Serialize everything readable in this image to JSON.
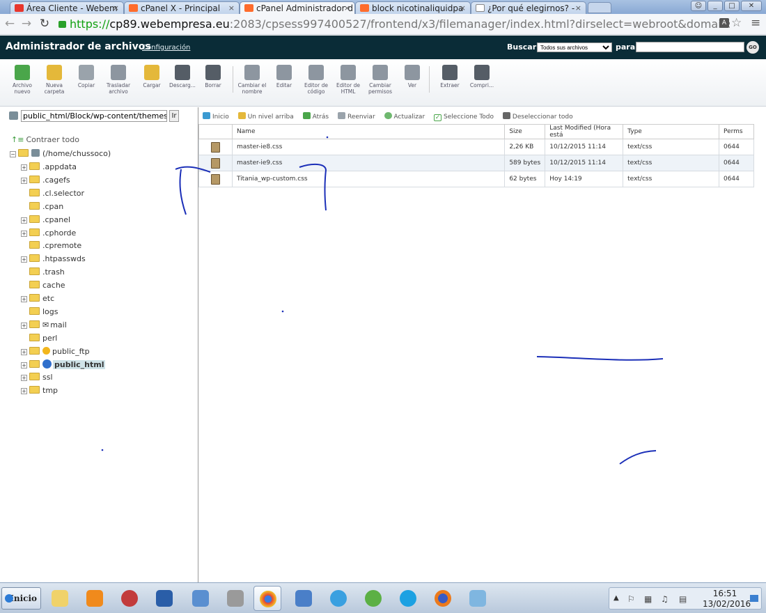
{
  "browser": {
    "tabs": [
      {
        "title": "Área Cliente - Webem",
        "icon_color": "#e8362d"
      },
      {
        "title": "cPanel X - Principal",
        "icon_color": "#ff6c2c"
      },
      {
        "title": "cPanel Administrador d",
        "icon_color": "#ff6c2c"
      },
      {
        "title": "block nicotinaliquidpa",
        "icon_color": "#ff6c2c"
      },
      {
        "title": "¿Por qué elegirnos? - ‎",
        "icon_color": "#dddddd"
      }
    ],
    "url_scheme": "https://",
    "url_host": "cp89.webempresa.eu",
    "url_rest": ":2083/cpsess997400527/frontend/x3/filemanager/index.html?dirselect=webroot&domainselect=block.nicotinaliquidaparavap"
  },
  "header": {
    "title": "Administrador de archivos",
    "config_link": "Configuración",
    "search_label": "Buscar",
    "search_scope": "Todos sus archivos",
    "for_label": "para",
    "go_label": "GO"
  },
  "toolbar": [
    {
      "label": "Archivo nuevo",
      "icon": "new-file-icon",
      "color": "#4aa64a"
    },
    {
      "label": "Nueva carpeta",
      "icon": "new-folder-icon",
      "color": "#e4b83a"
    },
    {
      "label": "Copiar",
      "icon": "copy-icon",
      "color": "#9aa3ab"
    },
    {
      "label": "Trasladar archivo",
      "icon": "move-file-icon",
      "color": "#8d96a0"
    },
    {
      "label": "Cargar",
      "icon": "upload-icon",
      "color": "#e4b83a"
    },
    {
      "label": "Descarg...",
      "icon": "download-icon",
      "color": "#555d66"
    },
    {
      "label": "Borrar",
      "icon": "delete-icon",
      "color": "#555d66"
    },
    {
      "label": "Cambiar el nombre",
      "icon": "rename-icon",
      "color": "#8d96a0"
    },
    {
      "label": "Editar",
      "icon": "edit-icon",
      "color": "#8d96a0"
    },
    {
      "label": "Editor de código",
      "icon": "code-editor-icon",
      "color": "#8d96a0"
    },
    {
      "label": "Editor de HTML",
      "icon": "html-editor-icon",
      "color": "#8d96a0"
    },
    {
      "label": "Cambiar permisos",
      "icon": "permissions-icon",
      "color": "#8d96a0"
    },
    {
      "label": "Ver",
      "icon": "view-icon",
      "color": "#8d96a0"
    },
    {
      "label": "Extraer",
      "icon": "extract-icon",
      "color": "#555d66"
    },
    {
      "label": "Compri...",
      "icon": "compress-icon",
      "color": "#555d66"
    }
  ],
  "left": {
    "path": "public_html/Block/wp-content/themes/titania",
    "go_button": "Ir",
    "collapse_all": "Contraer todo",
    "root": "(/home/chussoco)",
    "folders": [
      {
        "name": ".appdata",
        "expandable": true
      },
      {
        "name": ".cagefs",
        "expandable": true
      },
      {
        "name": ".cl.selector",
        "expandable": false
      },
      {
        "name": ".cpan",
        "expandable": false
      },
      {
        "name": ".cpanel",
        "expandable": true
      },
      {
        "name": ".cphorde",
        "expandable": true
      },
      {
        "name": ".cpremote",
        "expandable": false
      },
      {
        "name": ".htpasswds",
        "expandable": true
      },
      {
        "name": ".trash",
        "expandable": false
      },
      {
        "name": "cache",
        "expandable": false
      },
      {
        "name": "etc",
        "expandable": true
      },
      {
        "name": "logs",
        "expandable": false
      },
      {
        "name": "mail",
        "expandable": true
      },
      {
        "name": "perl",
        "expandable": false
      },
      {
        "name": "public_ftp",
        "expandable": true
      },
      {
        "name": "public_html",
        "expandable": true,
        "selected": true
      },
      {
        "name": "ssl",
        "expandable": true
      },
      {
        "name": "tmp",
        "expandable": true
      }
    ]
  },
  "nav": {
    "home": "Inicio",
    "up": "Un nivel arriba",
    "back": "Atrás",
    "forward": "Reenviar",
    "reload": "Actualizar",
    "select_all": "Seleccione Todo",
    "unselect_all": "Deseleccionar todo"
  },
  "files": {
    "columns": [
      "Name",
      "Size",
      "Last Modified (Hora está",
      "Type",
      "Perms"
    ],
    "rows": [
      [
        "master-ie8.css",
        "2,26 KB",
        "10/12/2015 11:14",
        "text/css",
        "0644"
      ],
      [
        "master-ie9.css",
        "589 bytes",
        "10/12/2015 11:14",
        "text/css",
        "0644"
      ],
      [
        "Titania_wp-custom.css",
        "62 bytes",
        "Hoy 14:19",
        "text/css",
        "0644"
      ]
    ]
  },
  "taskbar": {
    "start": "Inicio",
    "time": "16:51",
    "date": "13/02/2016"
  }
}
